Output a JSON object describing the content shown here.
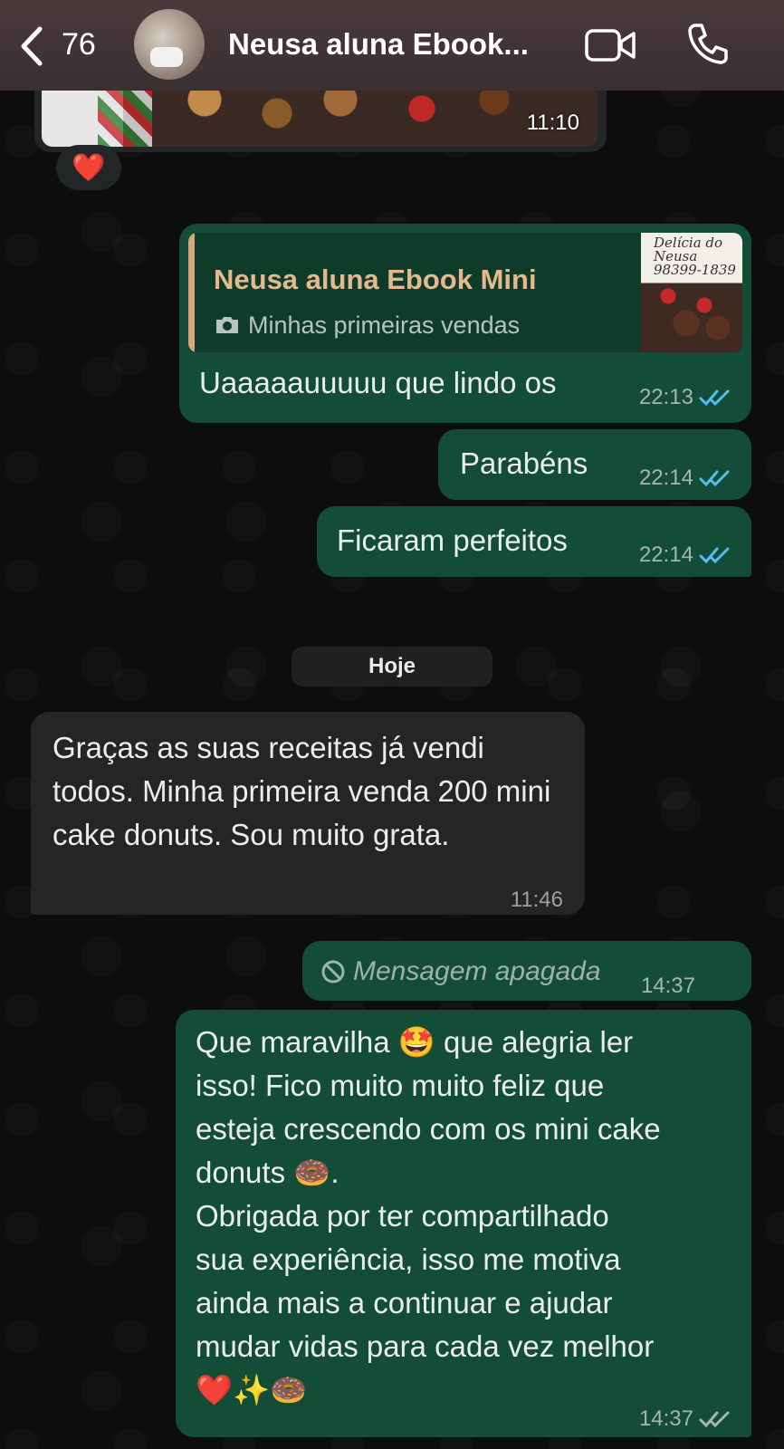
{
  "header": {
    "back_count": "76",
    "contact_name": "Neusa aluna Ebook...",
    "icons": [
      "back-chevron-icon",
      "video-call-icon",
      "phone-call-icon"
    ]
  },
  "messages": {
    "image_message": {
      "time": "11:10",
      "reaction": "❤️"
    },
    "reply_message": {
      "quote_name": "Neusa aluna Ebook Mini",
      "quote_text": "Minhas primeiras vendas",
      "quote_thumb_text": "Delícia do Neusa 98399-1839",
      "text": "Uaaaaauuuuu que lindo os",
      "time": "22:13"
    },
    "msg_parabens": {
      "text": "Parabéns",
      "time": "22:14"
    },
    "msg_perfeitos": {
      "text": "Ficaram perfeitos",
      "time": "22:14"
    },
    "date_separator": "Hoje",
    "incoming": {
      "text": "Graças  as suas receitas já vendi todos. Minha primeira venda 200 mini  cake donuts. Sou muito grata.",
      "time": "11:46"
    },
    "deleted": {
      "text": "Mensagem apagada",
      "time": "14:37"
    },
    "long_reply": {
      "line1": "Que maravilha 🤩 que alegria ler",
      "line2": "isso! Fico muito muito feliz que",
      "line3": "esteja crescendo com os mini cake",
      "line4": "donuts 🍩.",
      "line5": "Obrigada por ter compartilhado",
      "line6": "sua experiência, isso me motiva",
      "line7": "ainda mais a continuar e ajudar",
      "line8": "mudar vidas para cada vez melhor",
      "line9": "❤️✨🍩",
      "time": "14:37"
    }
  },
  "colors": {
    "header_bg": "#3f3335",
    "outgoing_bubble": "#144d37",
    "incoming_bubble": "#242626",
    "read_ticks": "#53bdeb",
    "quote_name": "#e6b98c"
  }
}
